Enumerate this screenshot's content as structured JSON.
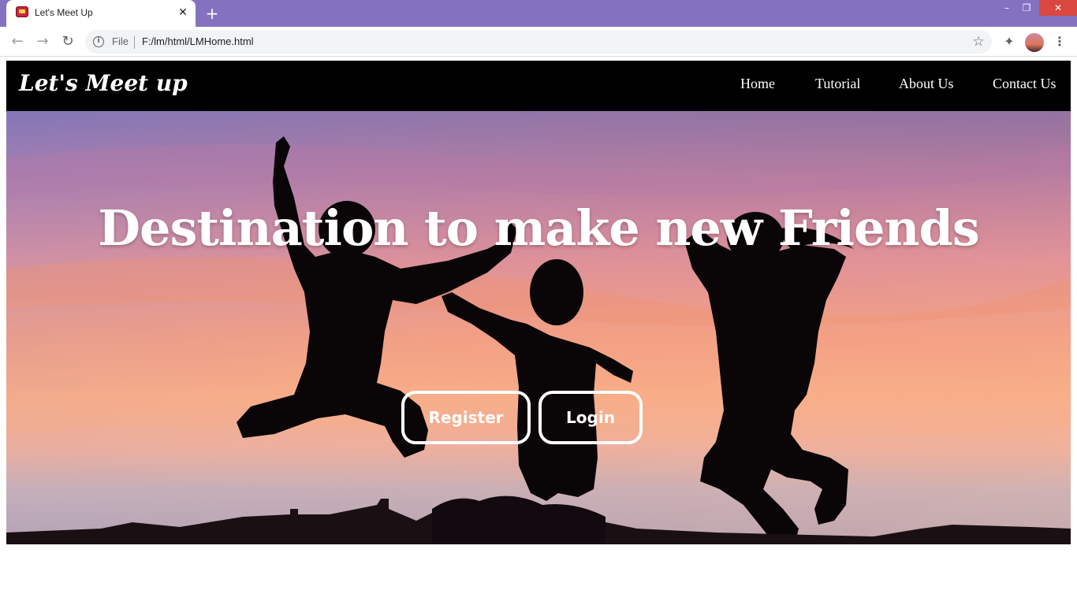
{
  "browser": {
    "tab_title": "Let's Meet Up",
    "tab_close_glyph": "✕",
    "new_tab_glyph": "+",
    "scheme_label": "File",
    "url": "F:/lm/html/LMHome.html",
    "window_controls": {
      "minimize": "–",
      "maximize": "❐",
      "close": "✕"
    },
    "icons": [
      "back-icon",
      "forward-icon",
      "reload-icon",
      "info-icon",
      "star-icon",
      "extensions-icon",
      "profile-avatar",
      "menu-icon"
    ]
  },
  "navbar": {
    "brand": "Let's Meet up",
    "links": [
      "Home",
      "Tutorial",
      "About Us",
      "Contact Us"
    ]
  },
  "hero": {
    "title": "Destination to make new Friends",
    "register_label": "Register",
    "login_label": "Login"
  },
  "colors": {
    "tabstrip": "#8472c0",
    "navbar_bg": "#000000",
    "close_button": "#d9473f",
    "text_white": "#ffffff"
  }
}
